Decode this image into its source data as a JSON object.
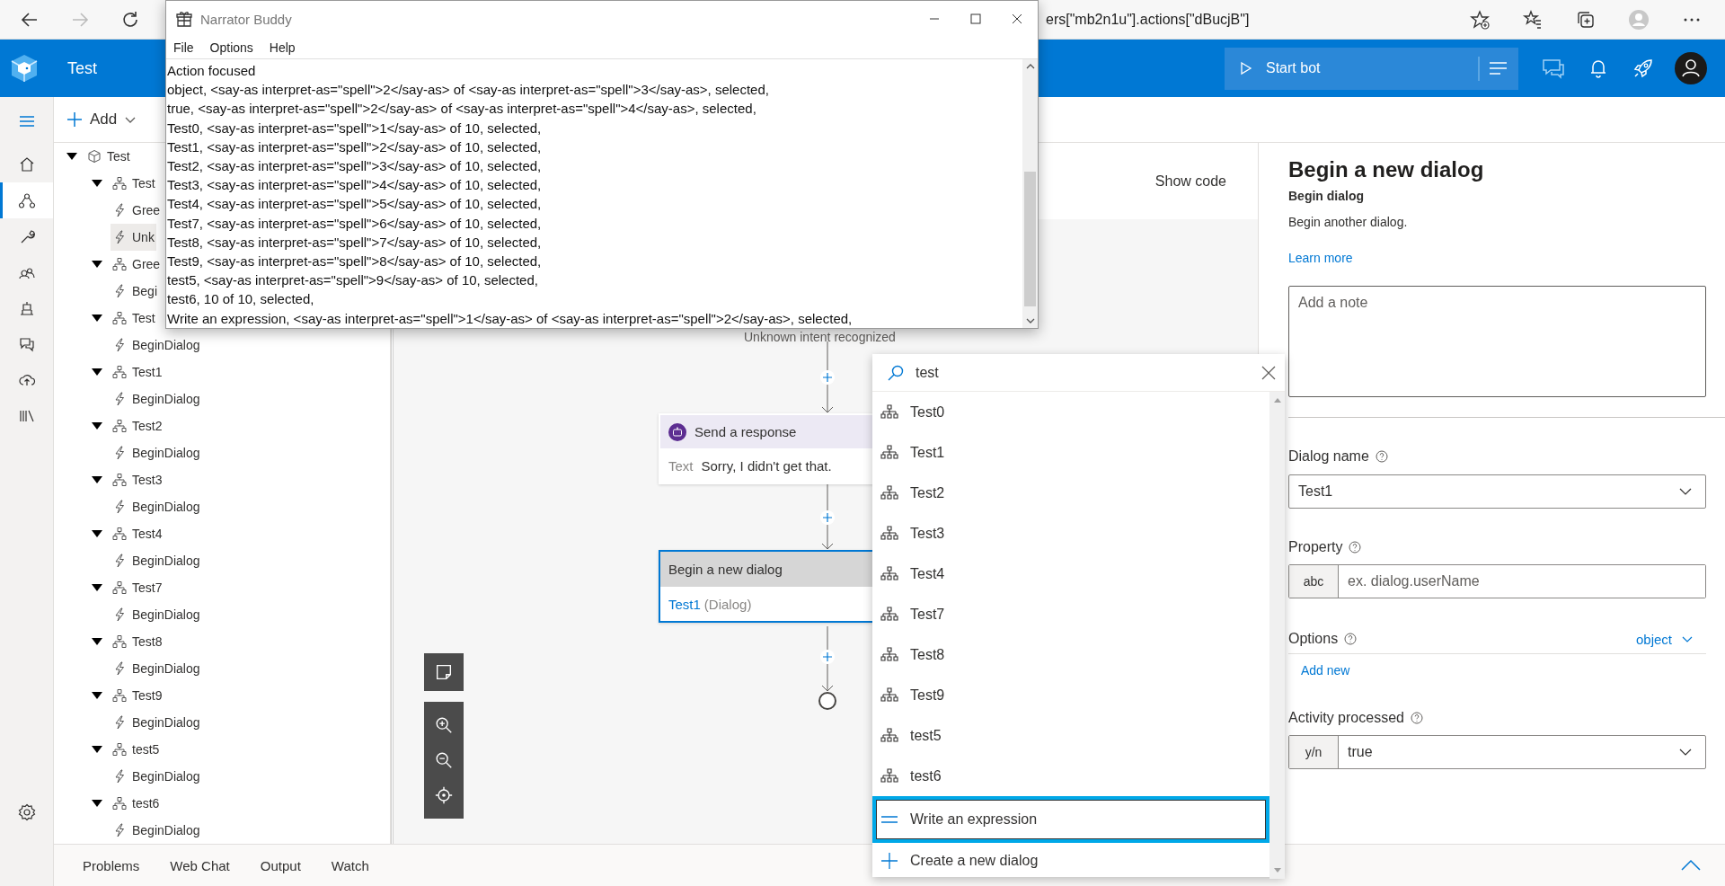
{
  "browser": {
    "address_fragment": "ers[\"mb2n1u\"].actions[\"dBucjB\"]"
  },
  "app": {
    "title": "Test",
    "start_bot": "Start bot"
  },
  "toolbar": {
    "add": "Add"
  },
  "rail": {
    "items": [
      {
        "selected": false
      },
      {
        "selected": true
      },
      {
        "selected": false
      },
      {
        "selected": false
      },
      {
        "selected": false
      },
      {
        "selected": false
      },
      {
        "selected": false
      },
      {
        "selected": false
      }
    ]
  },
  "tree": {
    "label": "Test",
    "kind": "bot",
    "expanded": true,
    "selected": false,
    "children": [
      {
        "label": "Test",
        "kind": "dialog",
        "expanded": true,
        "selected": false,
        "children": [
          {
            "label": "Gree",
            "kind": "trigger",
            "selected": false
          },
          {
            "label": "Unk",
            "kind": "trigger",
            "selected": true
          }
        ]
      },
      {
        "label": "Gree",
        "kind": "dialog",
        "expanded": true,
        "selected": false,
        "children": [
          {
            "label": "Begi",
            "kind": "trigger",
            "selected": false
          }
        ]
      },
      {
        "label": "Test",
        "kind": "dialog",
        "expanded": true,
        "selected": false,
        "children": [
          {
            "label": "BeginDialog",
            "kind": "trigger",
            "selected": false
          }
        ]
      },
      {
        "label": "Test1",
        "kind": "dialog",
        "expanded": true,
        "selected": false,
        "children": [
          {
            "label": "BeginDialog",
            "kind": "trigger",
            "selected": false
          }
        ]
      },
      {
        "label": "Test2",
        "kind": "dialog",
        "expanded": true,
        "selected": false,
        "children": [
          {
            "label": "BeginDialog",
            "kind": "trigger",
            "selected": false
          }
        ]
      },
      {
        "label": "Test3",
        "kind": "dialog",
        "expanded": true,
        "selected": false,
        "children": [
          {
            "label": "BeginDialog",
            "kind": "trigger",
            "selected": false
          }
        ]
      },
      {
        "label": "Test4",
        "kind": "dialog",
        "expanded": true,
        "selected": false,
        "children": [
          {
            "label": "BeginDialog",
            "kind": "trigger",
            "selected": false
          }
        ]
      },
      {
        "label": "Test7",
        "kind": "dialog",
        "expanded": true,
        "selected": false,
        "children": [
          {
            "label": "BeginDialog",
            "kind": "trigger",
            "selected": false
          }
        ]
      },
      {
        "label": "Test8",
        "kind": "dialog",
        "expanded": true,
        "selected": false,
        "children": [
          {
            "label": "BeginDialog",
            "kind": "trigger",
            "selected": false
          }
        ]
      },
      {
        "label": "Test9",
        "kind": "dialog",
        "expanded": true,
        "selected": false,
        "children": [
          {
            "label": "BeginDialog",
            "kind": "trigger",
            "selected": false
          }
        ]
      },
      {
        "label": "test5",
        "kind": "dialog",
        "expanded": true,
        "selected": false,
        "children": [
          {
            "label": "BeginDialog",
            "kind": "trigger",
            "selected": false
          }
        ]
      },
      {
        "label": "test6",
        "kind": "dialog",
        "expanded": true,
        "selected": false,
        "children": [
          {
            "label": "BeginDialog",
            "kind": "trigger",
            "selected": false
          }
        ]
      }
    ]
  },
  "narrator": {
    "title": "Narrator Buddy",
    "menu": [
      "File",
      "Options",
      "Help"
    ],
    "lines": [
      "Action focused",
      "object, <say-as interpret-as=\"spell\">2</say-as> of <say-as interpret-as=\"spell\">3</say-as>, selected,",
      "true, <say-as interpret-as=\"spell\">2</say-as> of <say-as interpret-as=\"spell\">4</say-as>, selected,",
      "Test0, <say-as interpret-as=\"spell\">1</say-as> of 10, selected,",
      "Test1, <say-as interpret-as=\"spell\">2</say-as> of 10, selected,",
      "Test2, <say-as interpret-as=\"spell\">3</say-as> of 10, selected,",
      "Test3, <say-as interpret-as=\"spell\">4</say-as> of 10, selected,",
      "Test4, <say-as interpret-as=\"spell\">5</say-as> of 10, selected,",
      "Test7, <say-as interpret-as=\"spell\">6</say-as> of 10, selected,",
      "Test8, <say-as interpret-as=\"spell\">7</say-as> of 10, selected,",
      "Test9, <say-as interpret-as=\"spell\">8</say-as> of 10, selected,",
      "test5, <say-as interpret-as=\"spell\">9</say-as> of 10, selected,",
      "test6, 10 of 10, selected,",
      "Write an expression, <say-as interpret-as=\"spell\">1</say-as> of <say-as interpret-as=\"spell\">2</say-as>, selected,"
    ]
  },
  "canvas": {
    "show_code": "Show code",
    "trigger_label": "Unknown intent recognized",
    "nodes": [
      {
        "kind": "response",
        "title": "Send a response",
        "field_label": "Text",
        "value": "Sorry, I didn't get that.",
        "selected": false
      },
      {
        "kind": "dialog",
        "title": "Begin a new dialog",
        "link": "Test1",
        "suffix": "(Dialog)",
        "selected": true
      }
    ]
  },
  "picker": {
    "query": "test",
    "options": [
      {
        "label": "Test0",
        "kind": "dialog",
        "selected": false
      },
      {
        "label": "Test1",
        "kind": "dialog",
        "selected": false
      },
      {
        "label": "Test2",
        "kind": "dialog",
        "selected": false
      },
      {
        "label": "Test3",
        "kind": "dialog",
        "selected": false
      },
      {
        "label": "Test4",
        "kind": "dialog",
        "selected": false
      },
      {
        "label": "Test7",
        "kind": "dialog",
        "selected": false
      },
      {
        "label": "Test8",
        "kind": "dialog",
        "selected": false
      },
      {
        "label": "Test9",
        "kind": "dialog",
        "selected": false
      },
      {
        "label": "test5",
        "kind": "dialog",
        "selected": false
      },
      {
        "label": "test6",
        "kind": "dialog",
        "selected": false
      },
      {
        "label": "Write an expression",
        "kind": "expression",
        "selected": true
      },
      {
        "label": "Create a new dialog",
        "kind": "create",
        "selected": false
      }
    ]
  },
  "properties": {
    "title": "Begin a new dialog",
    "subtitle": "Begin dialog",
    "description": "Begin another dialog.",
    "learn_more": "Learn more",
    "note": {
      "placeholder": "Add a note"
    },
    "dialog_name": {
      "label": "Dialog name",
      "value": "Test1"
    },
    "property": {
      "label": "Property",
      "prefix": "abc",
      "placeholder": "ex. dialog.userName"
    },
    "options": {
      "label": "Options",
      "type": "object",
      "add": "Add new"
    },
    "activity": {
      "label": "Activity processed",
      "prefix": "y/n",
      "value": "true"
    }
  },
  "bottom_tabs": [
    "Problems",
    "Web Chat",
    "Output",
    "Watch"
  ]
}
